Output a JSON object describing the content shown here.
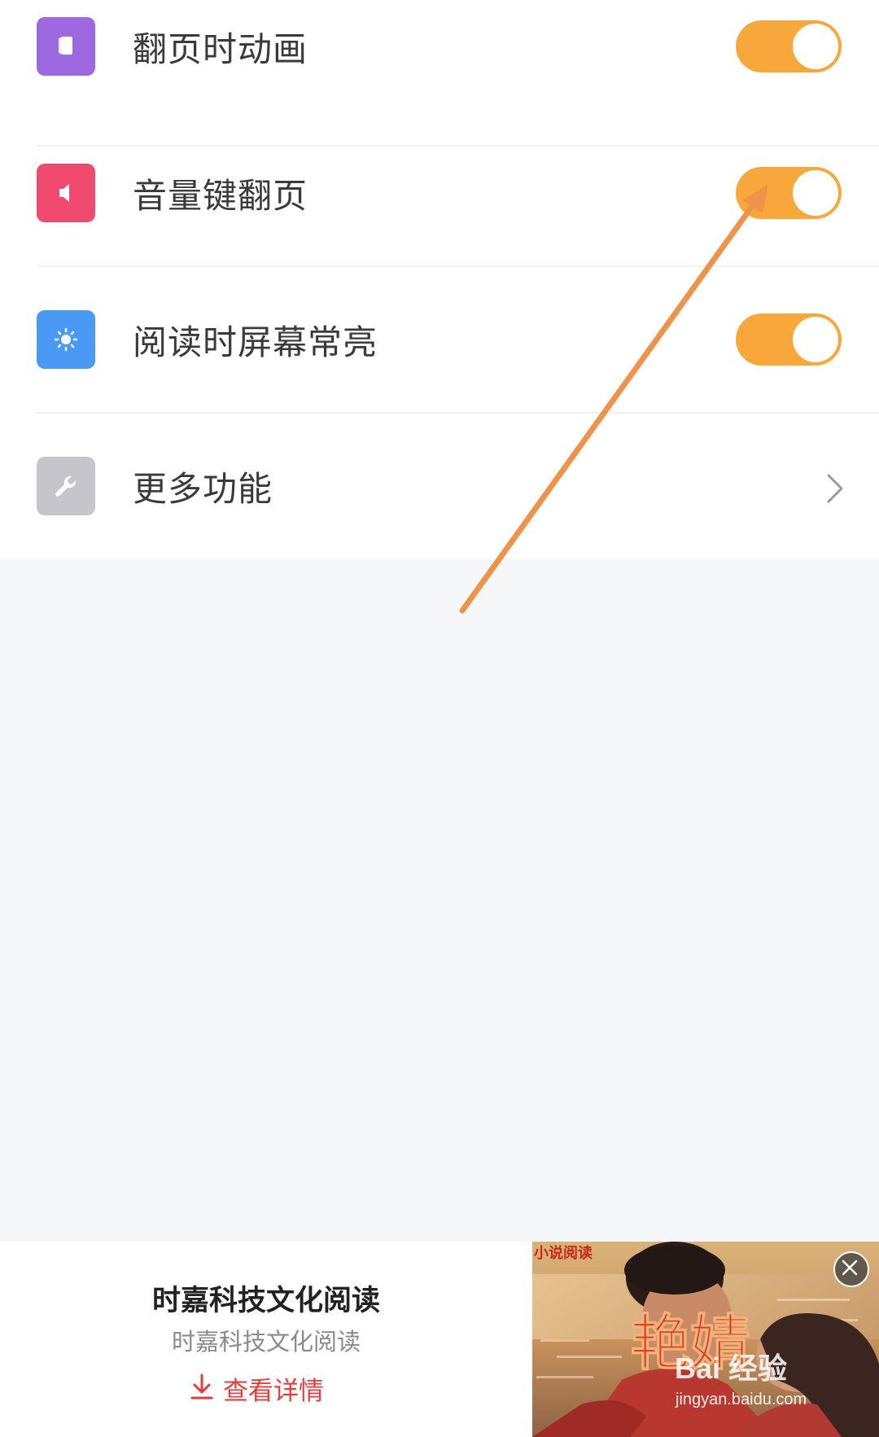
{
  "settings": {
    "items": [
      {
        "label": "翻页时动画",
        "icon": "page-icon",
        "icon_color": "#9c69e0",
        "control": "toggle",
        "enabled": true
      },
      {
        "label": "音量键翻页",
        "icon": "speaker-icon",
        "icon_color": "#f04a6e",
        "control": "toggle",
        "enabled": true
      },
      {
        "label": "阅读时屏幕常亮",
        "icon": "brightness-icon",
        "icon_color": "#4a9af5",
        "control": "toggle",
        "enabled": true
      },
      {
        "label": "更多功能",
        "icon": "wrench-icon",
        "icon_color": "#c5c5cb",
        "control": "chevron"
      }
    ],
    "toggle_on_color": "#f8a73a"
  },
  "ad": {
    "title": "时嘉科技文化阅读",
    "subtitle": "时嘉科技文化阅读",
    "detail_label": "查看详情",
    "detail_icon": "download-icon",
    "image_caption": "小说阅读",
    "image_headline": "艳婧",
    "watermark_brand": "Bai 经验",
    "watermark_url": "jingyan.baidu.com",
    "close_icon": "close-icon"
  },
  "annotation": {
    "arrow_color": "#f0934a"
  }
}
